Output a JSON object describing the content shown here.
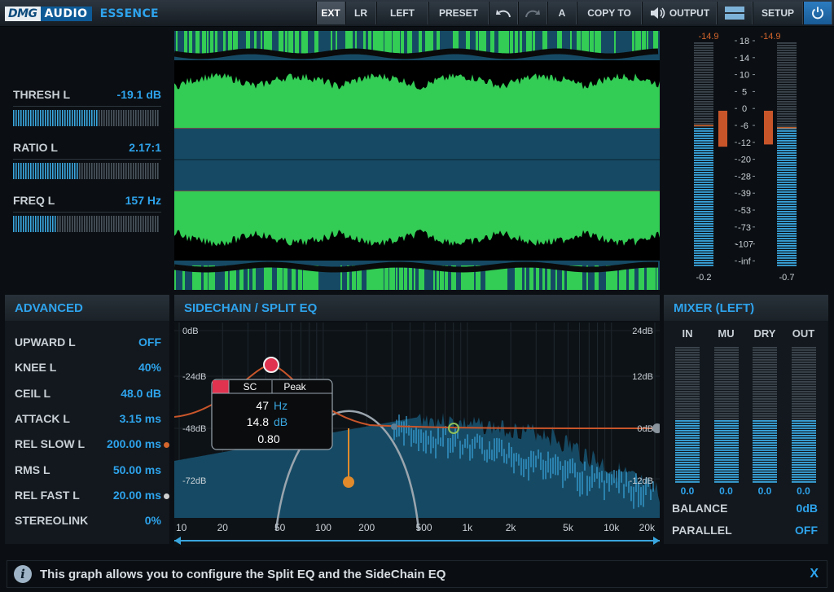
{
  "app": {
    "brand_left": "DMG",
    "brand_right": "AUDIO",
    "product": "ESSENCE"
  },
  "toolbar": {
    "ext": "EXT",
    "lr": "LR",
    "left": "LEFT",
    "preset": "PRESET",
    "undo_icon": "undo-arrow",
    "redo_icon": "redo-arrow",
    "ab": "A",
    "copy_to": "COPY TO",
    "output_icon": "speaker",
    "output": "OUTPUT",
    "menu_icon": "hamburger",
    "setup": "SETUP",
    "power_icon": "power"
  },
  "params": [
    {
      "label": "THRESH L",
      "value": "-19.1 dB",
      "level": 0.57
    },
    {
      "label": "RATIO L",
      "value": "2.17:1",
      "level": 0.45
    },
    {
      "label": "FREQ L",
      "value": "157 Hz",
      "level": 0.3
    }
  ],
  "meters": {
    "left_peak": "-14.9",
    "right_peak": "-14.9",
    "left_value": "-0.2",
    "right_value": "-0.7",
    "scale": [
      "18",
      "14",
      "10",
      "5",
      "0",
      "-6",
      "-12",
      "-20",
      "-28",
      "-39",
      "-53",
      "-73",
      "-107",
      "-inf"
    ],
    "left_level": 0.63,
    "right_level": 0.62,
    "left_gr": 0.16,
    "right_gr": 0.15
  },
  "advanced": {
    "title": "ADVANCED",
    "rows": [
      {
        "label": "UPWARD L",
        "value": "OFF",
        "dot": ""
      },
      {
        "label": "KNEE L",
        "value": "40%",
        "dot": ""
      },
      {
        "label": "CEIL L",
        "value": "48.0 dB",
        "dot": ""
      },
      {
        "label": "ATTACK L",
        "value": "3.15 ms",
        "dot": ""
      },
      {
        "label": "REL SLOW L",
        "value": "200.00 ms",
        "dot": "#d4652c"
      },
      {
        "label": "RMS L",
        "value": "50.00 ms",
        "dot": ""
      },
      {
        "label": "REL FAST L",
        "value": "20.00 ms",
        "dot": "#cfcfcf"
      },
      {
        "label": "STEREOLINK",
        "value": "0%",
        "dot": ""
      }
    ]
  },
  "eq": {
    "title": "SIDECHAIN / SPLIT EQ",
    "left_scale": [
      "0dB",
      "-24dB",
      "-48dB",
      "-72dB"
    ],
    "right_scale": [
      "24dB",
      "12dB",
      "0dB",
      "-12dB"
    ],
    "freq_labels": [
      "10",
      "20",
      "50",
      "100",
      "200",
      "500",
      "1k",
      "2k",
      "5k",
      "10k",
      "20k"
    ],
    "popup": {
      "tab1": "SC",
      "tab2": "Peak",
      "freq_value": "47",
      "freq_unit": "Hz",
      "gain_value": "14.8",
      "gain_unit": "dB",
      "q_value": "0.80"
    }
  },
  "mixer": {
    "title": "MIXER (LEFT)",
    "channels": [
      {
        "label": "IN",
        "value": "0.0",
        "level": 0.47
      },
      {
        "label": "MU",
        "value": "0.0",
        "level": 0.47
      },
      {
        "label": "DRY",
        "value": "0.0",
        "level": 0.47
      },
      {
        "label": "OUT",
        "value": "0.0",
        "level": 0.47
      }
    ],
    "balance_label": "BALANCE",
    "balance_value": "0dB",
    "parallel_label": "PARALLEL",
    "parallel_value": "OFF"
  },
  "status": {
    "icon": "i",
    "text": "This graph allows you to configure the Split EQ and the SideChain EQ",
    "close": "X"
  },
  "colors": {
    "accent": "#2ea3ec",
    "wave_green": "#33cc55",
    "band_blue": "#164a64",
    "eq_curve": "#c8552a",
    "node_red": "#e0334f",
    "node_orange": "#e08a2c"
  }
}
